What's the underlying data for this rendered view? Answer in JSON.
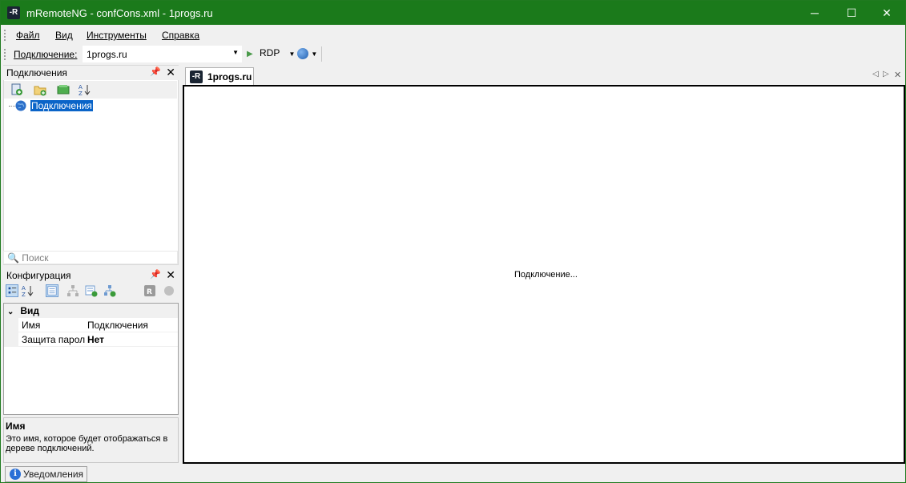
{
  "window": {
    "title": "mRemoteNG - confCons.xml - 1progs.ru",
    "app_icon_text": "-R",
    "controls": {
      "minimize": "─",
      "maximize": "☐",
      "close": "✕"
    }
  },
  "menu": {
    "items": [
      {
        "label": "Файл"
      },
      {
        "label": "Вид"
      },
      {
        "label": "Инструменты"
      },
      {
        "label": "Справка"
      }
    ]
  },
  "toolbar": {
    "connection_label": "Подключение:",
    "connection_value": "1progs.ru",
    "protocol": "RDP"
  },
  "connections_panel": {
    "title": "Подключения",
    "pin_icon": "pin-icon",
    "close_icon": "close-icon",
    "tree_root": "Подключения",
    "search_placeholder": "Поиск"
  },
  "config_panel": {
    "title": "Конфигурация",
    "category": "Вид",
    "properties": [
      {
        "name": "Имя",
        "value": "Подключения"
      },
      {
        "name": "Защита пароле",
        "value": "Нет"
      }
    ],
    "help_title": "Имя",
    "help_text": "Это имя, которое будет отображаться в дереве подключений."
  },
  "document": {
    "tab_label": "1progs.ru",
    "status_message": "Подключение..."
  },
  "status_bar": {
    "notifications_label": "Уведомления"
  },
  "colors": {
    "title_bar": "#1b7a1b",
    "selection": "#0a64c8"
  }
}
